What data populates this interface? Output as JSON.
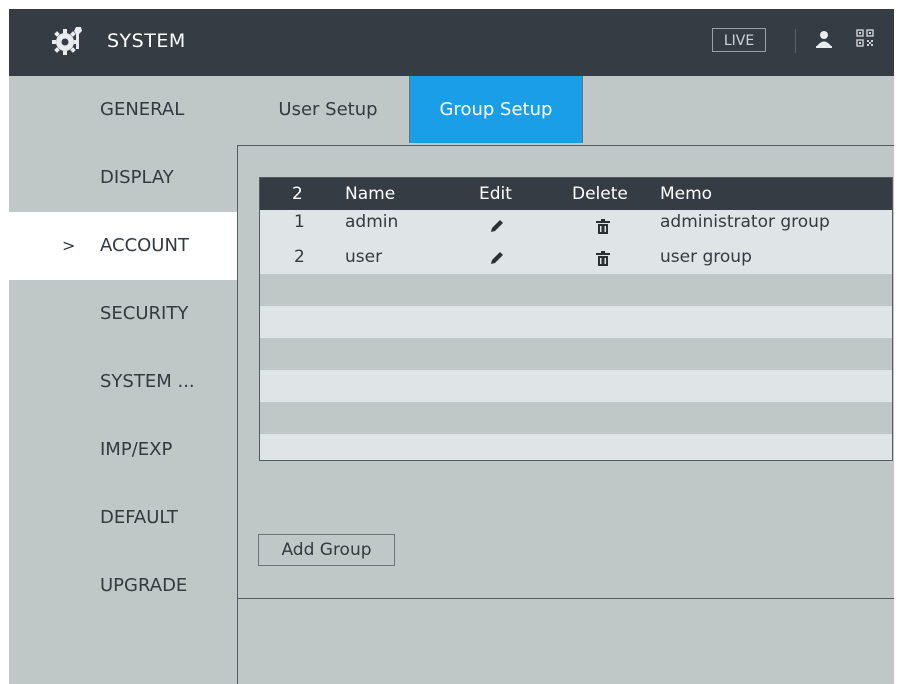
{
  "header": {
    "title": "SYSTEM",
    "live_label": "LIVE",
    "icons": [
      "gear-icon",
      "user-icon",
      "qr-code-icon"
    ]
  },
  "sidebar": {
    "items": [
      {
        "label": "GENERAL",
        "active": false
      },
      {
        "label": "DISPLAY",
        "active": false
      },
      {
        "label": "ACCOUNT",
        "active": true
      },
      {
        "label": "SECURITY",
        "active": false
      },
      {
        "label": "SYSTEM ...",
        "active": false
      },
      {
        "label": "IMP/EXP",
        "active": false
      },
      {
        "label": "DEFAULT",
        "active": false
      },
      {
        "label": "UPGRADE",
        "active": false
      }
    ],
    "active_marker": ">"
  },
  "tabs": [
    {
      "label": "User Setup",
      "selected": false
    },
    {
      "label": "Group Setup",
      "selected": true
    }
  ],
  "table": {
    "headers": {
      "no": "2",
      "name": "Name",
      "edit": "Edit",
      "delete": "Delete",
      "memo": "Memo"
    },
    "rows": [
      {
        "no": "1",
        "name": "admin",
        "memo": "administrator group"
      },
      {
        "no": "2",
        "name": "user",
        "memo": "user group"
      }
    ]
  },
  "buttons": {
    "add_group": "Add Group"
  },
  "colors": {
    "header_bg": "#363c44",
    "panel_bg": "#bfc7c7",
    "accent": "#1a9ee8",
    "row_light": "#dfe4e6"
  }
}
